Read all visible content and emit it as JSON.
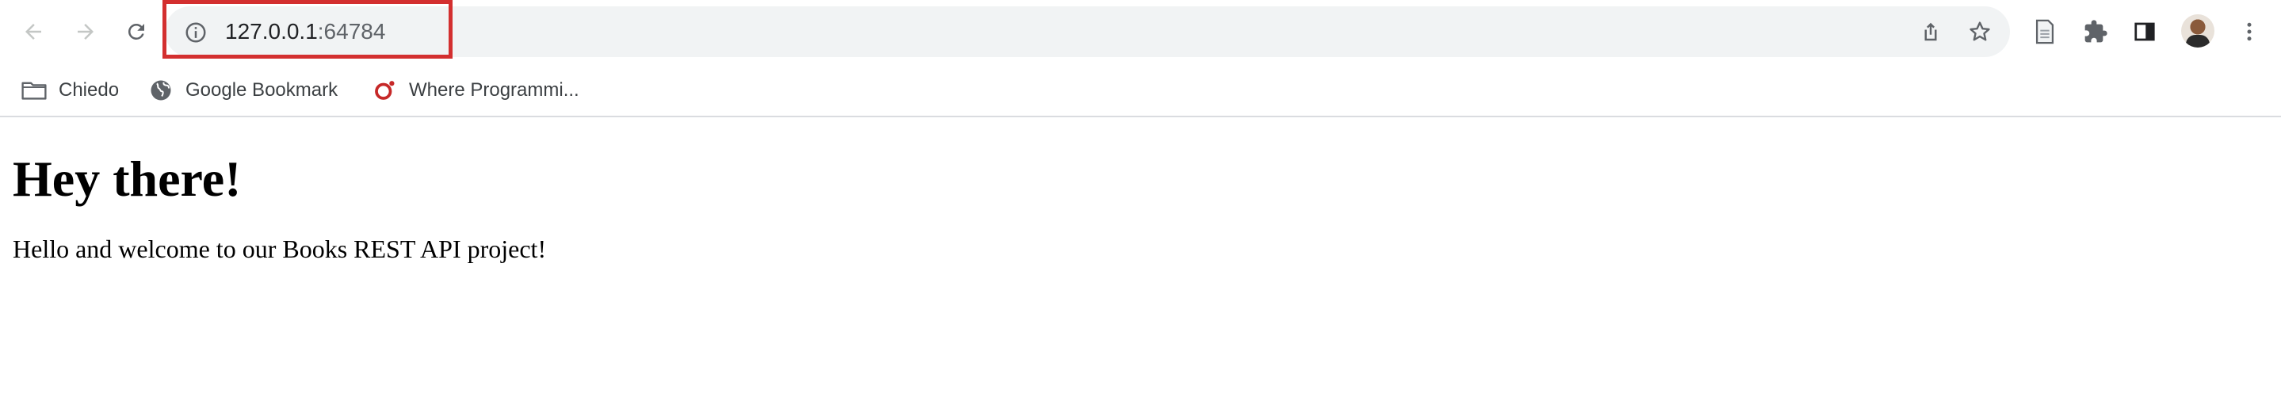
{
  "browser": {
    "address_bar": {
      "host": "127.0.0.1",
      "port": ":64784"
    },
    "icons": {
      "back": "back-arrow-icon",
      "forward": "forward-arrow-icon",
      "reload": "reload-icon",
      "site_info": "info-icon",
      "share": "share-icon",
      "bookmark_star": "star-icon",
      "reading_list": "document-icon",
      "extensions": "puzzle-icon",
      "side_panel": "side-panel-icon",
      "menu": "kebab-menu-icon"
    },
    "highlight_color": "#d32f2f"
  },
  "bookmarks": [
    {
      "label": "Chiedo",
      "icon": "folder-icon"
    },
    {
      "label": "Google Bookmark",
      "icon": "globe-icon"
    },
    {
      "label": "Where Programmi...",
      "icon": "site-logo-icon"
    }
  ],
  "page": {
    "heading": "Hey there!",
    "paragraph": "Hello and welcome to our Books REST API project!"
  }
}
